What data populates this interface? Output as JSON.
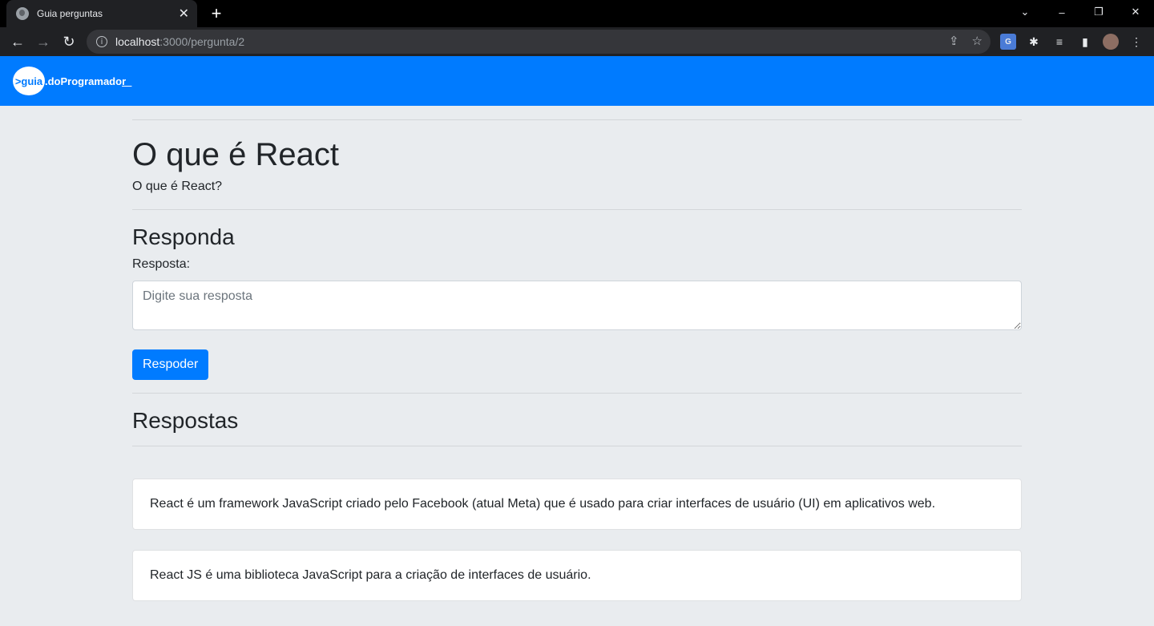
{
  "browser": {
    "tab_title": "Guia perguntas",
    "tab_close": "✕",
    "new_tab": "+",
    "url_host": "localhost",
    "url_path": ":3000/pergunta/2",
    "window_controls": [
      "⌄",
      "–",
      "❐",
      "✕"
    ]
  },
  "site": {
    "logo_mark": ">guia",
    "logo_text": ".doProgramado",
    "logo_cursor": "r_"
  },
  "question": {
    "title": "O que é React",
    "description": "O que é React?"
  },
  "answer_form": {
    "heading": "Responda",
    "label": "Resposta:",
    "placeholder": "Digite sua resposta",
    "button": "Respoder"
  },
  "answers": {
    "heading": "Respostas",
    "items": [
      "React é um framework JavaScript criado pelo Facebook (atual Meta) que é usado para criar interfaces de usuário (UI) em aplicativos web.",
      "React JS é uma biblioteca JavaScript para a criação de interfaces de usuário."
    ]
  }
}
